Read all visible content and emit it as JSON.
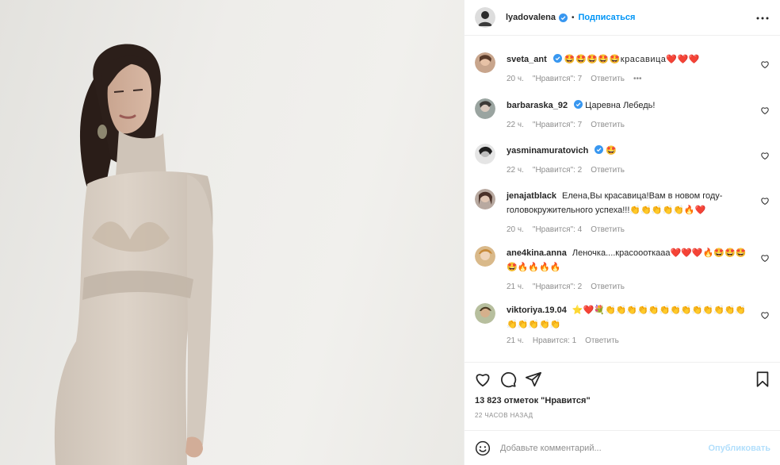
{
  "post": {
    "author": "lyadovalena",
    "separator": "•",
    "follow_label": "Подписаться"
  },
  "comments": [
    {
      "user": "sveta_ant",
      "verified": true,
      "text": "🤩🤩🤩🤩🤩красавица❤️❤️❤️",
      "age": "20 ч.",
      "likes": "\"Нравится\": 7",
      "reply": "Ответить",
      "more": "•••"
    },
    {
      "user": "barbaraska_92",
      "verified": true,
      "text": "Царевна Лебедь!",
      "age": "22 ч.",
      "likes": "\"Нравится\": 7",
      "reply": "Ответить"
    },
    {
      "user": "yasminamuratovich",
      "verified": true,
      "text": "🤩",
      "age": "22 ч.",
      "likes": "\"Нравится\": 2",
      "reply": "Ответить"
    },
    {
      "user": "jenajatblack",
      "verified": false,
      "text": "Елена,Вы красавица!Вам в новом году-головокружительного успеха!!!👏👏👏👏👏🔥❤️",
      "age": "20 ч.",
      "likes": "\"Нравится\": 4",
      "reply": "Ответить"
    },
    {
      "user": "ane4kina.anna",
      "verified": false,
      "text": "Леночка....красоооткааа❤️❤️❤️🔥🤩🤩🤩🤩🔥🔥🔥🔥",
      "age": "21 ч.",
      "likes": "\"Нравится\": 2",
      "reply": "Ответить"
    },
    {
      "user": "viktoriya.19.04",
      "verified": false,
      "text": "⭐❤️💐👏👏👏👏👏👏👏👏👏👏👏👏👏👏👏👏👏👏",
      "age": "21 ч.",
      "likes": "Нравится: 1",
      "reply": "Ответить"
    }
  ],
  "likes_text": "13 823 отметок \"Нравится\"",
  "posted_ago": "22 ЧАСОВ НАЗАД",
  "add_comment": {
    "placeholder": "Добавьте комментарий...",
    "publish_label": "Опубликовать"
  },
  "colors": {
    "accent": "#0095f6",
    "publish_disabled": "#b2dffc",
    "text": "#262626",
    "muted": "#8e8e8e"
  }
}
